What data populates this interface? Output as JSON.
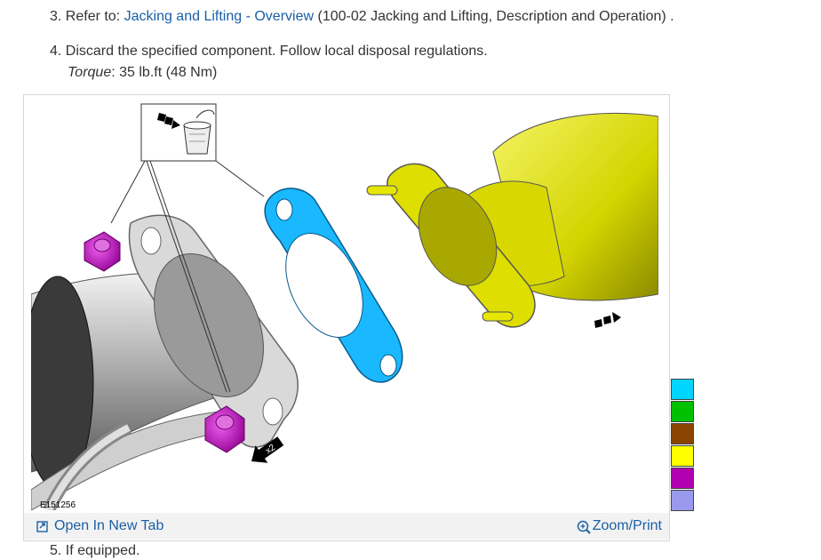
{
  "steps": {
    "step3_prefix": "3. Refer to:",
    "step3_link": "Jacking and Lifting - Overview",
    "step3_suffix": "(100-02 Jacking and Lifting, Description and Operation) .",
    "step4_text": "4. Discard the specified component. Follow local disposal regulations.",
    "torque_label": "Torque",
    "torque_value": ": 35 lb.ft (48 Nm)",
    "step5_text": "5. If equipped."
  },
  "figure": {
    "id_label": "E151256",
    "callout_count": "x2",
    "open_tab_label": "Open In New Tab",
    "zoom_print_label": "Zoom/Print",
    "icons": [
      "open-new-tab-icon",
      "zoom-in-icon",
      "disposal-bin-icon",
      "arrow-icon"
    ]
  },
  "legend": {
    "colors": [
      "#00d5ff",
      "#00c000",
      "#8b4500",
      "#ffff00",
      "#b000b0",
      "#9999ee"
    ]
  },
  "colors": {
    "link": "#1a5fa6",
    "gasket": "#1ab8ff",
    "nut": "#c000c0",
    "catalytic_converter": "#d8d800",
    "pipe": "#c8c8c8"
  }
}
